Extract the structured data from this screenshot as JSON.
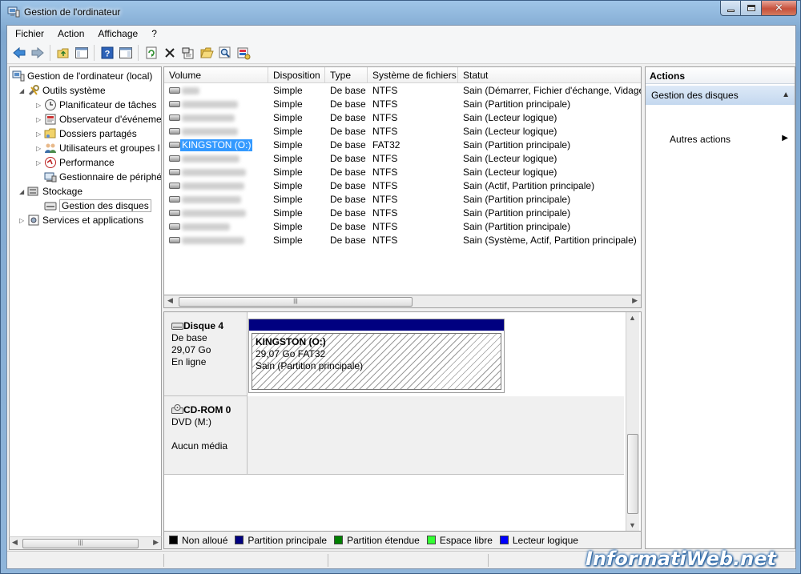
{
  "window": {
    "title": "Gestion de l'ordinateur"
  },
  "menu": [
    "Fichier",
    "Action",
    "Affichage",
    "?"
  ],
  "tree": {
    "root": "Gestion de l'ordinateur (local)",
    "system_tools": "Outils système",
    "task_scheduler": "Planificateur de tâches",
    "event_viewer": "Observateur d'événeme",
    "shared_folders": "Dossiers partagés",
    "local_users": "Utilisateurs et groupes l",
    "performance": "Performance",
    "device_manager": "Gestionnaire de périphé",
    "storage": "Stockage",
    "disk_management": "Gestion des disques",
    "services": "Services et applications"
  },
  "columns": [
    "Volume",
    "Disposition",
    "Type",
    "Système de fichiers",
    "Statut"
  ],
  "volumes": [
    {
      "name": "",
      "layout": "Simple",
      "type": "De base",
      "fs": "NTFS",
      "status": "Sain (Démarrer, Fichier d'échange, Vidage"
    },
    {
      "name": "",
      "layout": "Simple",
      "type": "De base",
      "fs": "NTFS",
      "status": "Sain (Partition principale)"
    },
    {
      "name": "",
      "layout": "Simple",
      "type": "De base",
      "fs": "NTFS",
      "status": "Sain (Lecteur logique)"
    },
    {
      "name": "",
      "layout": "Simple",
      "type": "De base",
      "fs": "NTFS",
      "status": "Sain (Lecteur logique)"
    },
    {
      "name": "KINGSTON (O:)",
      "layout": "Simple",
      "type": "De base",
      "fs": "FAT32",
      "status": "Sain (Partition principale)"
    },
    {
      "name": "",
      "layout": "Simple",
      "type": "De base",
      "fs": "NTFS",
      "status": "Sain (Lecteur logique)"
    },
    {
      "name": "",
      "layout": "Simple",
      "type": "De base",
      "fs": "NTFS",
      "status": "Sain (Lecteur logique)"
    },
    {
      "name": "",
      "layout": "Simple",
      "type": "De base",
      "fs": "NTFS",
      "status": "Sain (Actif, Partition principale)"
    },
    {
      "name": "",
      "layout": "Simple",
      "type": "De base",
      "fs": "NTFS",
      "status": "Sain (Partition principale)"
    },
    {
      "name": "",
      "layout": "Simple",
      "type": "De base",
      "fs": "NTFS",
      "status": "Sain (Partition principale)"
    },
    {
      "name": "",
      "layout": "Simple",
      "type": "De base",
      "fs": "NTFS",
      "status": "Sain (Partition principale)"
    },
    {
      "name": "",
      "layout": "Simple",
      "type": "De base",
      "fs": "NTFS",
      "status": "Sain (Système, Actif, Partition principale)"
    }
  ],
  "disk4": {
    "name": "Disque 4",
    "type": "De base",
    "size": "29,07 Go",
    "state": "En ligne",
    "partition_name": "KINGSTON  (O:)",
    "partition_size": "29,07 Go FAT32",
    "partition_status": "Sain (Partition principale)"
  },
  "cdrom": {
    "name": "CD-ROM 0",
    "drive": "DVD (M:)",
    "media": "Aucun média"
  },
  "legend": [
    {
      "label": "Non alloué",
      "color": "#000000"
    },
    {
      "label": "Partition principale",
      "color": "#000080"
    },
    {
      "label": "Partition étendue",
      "color": "#008000"
    },
    {
      "label": "Espace libre",
      "color": "#33ff33"
    },
    {
      "label": "Lecteur logique",
      "color": "#0000ff"
    }
  ],
  "actions": {
    "title": "Actions",
    "group": "Gestion des disques",
    "more": "Autres actions"
  },
  "watermark": "InformatiWeb.net"
}
